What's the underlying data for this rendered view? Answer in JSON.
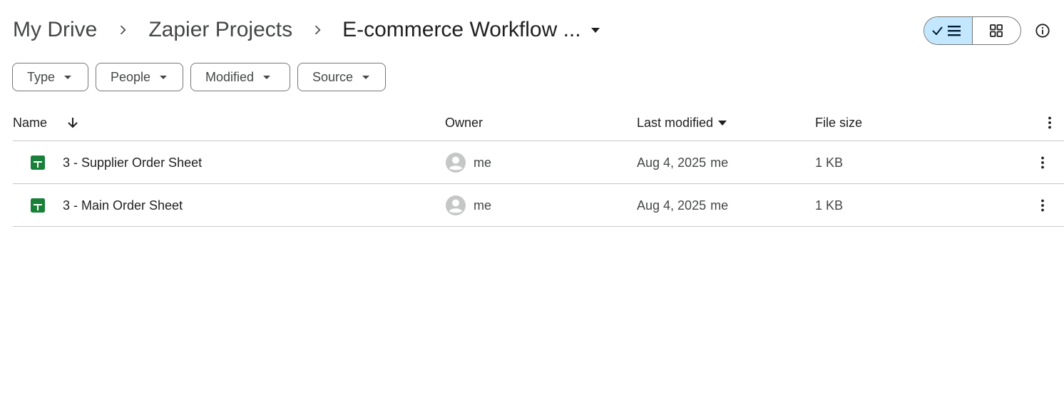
{
  "breadcrumb": {
    "items": [
      {
        "label": "My Drive"
      },
      {
        "label": "Zapier Projects"
      },
      {
        "label": "E-commerce Workflow ..."
      }
    ]
  },
  "view_toggle": {
    "active": "list",
    "list_icon": "check-list-icon",
    "grid_icon": "grid-icon"
  },
  "filters": [
    {
      "label": "Type"
    },
    {
      "label": "People"
    },
    {
      "label": "Modified"
    },
    {
      "label": "Source"
    }
  ],
  "table": {
    "columns": {
      "name": "Name",
      "owner": "Owner",
      "last_modified": "Last modified",
      "file_size": "File size"
    },
    "rows": [
      {
        "name": "3 - Supplier Order Sheet",
        "owner": "me",
        "modified_date": "Aug 4, 2025",
        "modified_by": "me",
        "size": "1 KB",
        "icon": "google-sheets-icon"
      },
      {
        "name": "3 - Main Order Sheet",
        "owner": "me",
        "modified_date": "Aug 4, 2025",
        "modified_by": "me",
        "size": "1 KB",
        "icon": "google-sheets-icon"
      }
    ]
  },
  "colors": {
    "sheets_green": "#188038",
    "toggle_active": "#c2e7ff",
    "divider": "#c7c7c7",
    "text_primary": "#1f1f1f",
    "text_secondary": "#444746"
  }
}
